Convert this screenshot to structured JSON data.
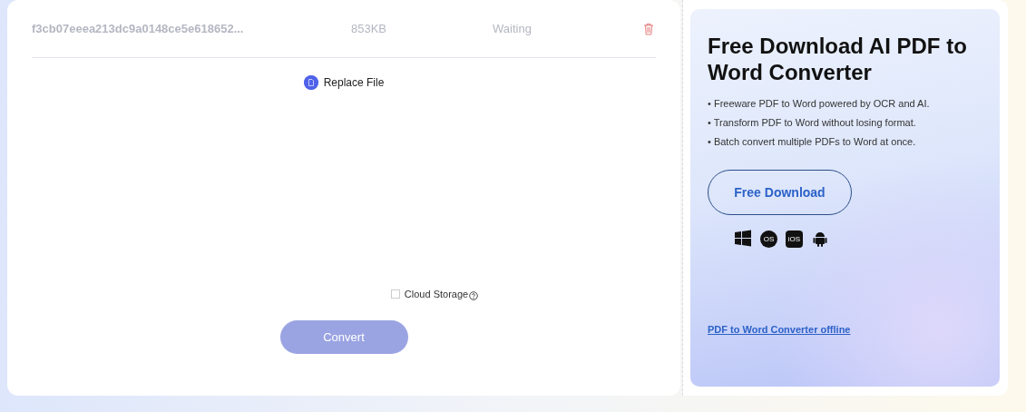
{
  "file_row": {
    "name": "f3cb07eeea213dc9a0148ce5e618652...",
    "size": "853KB",
    "status": "Waiting"
  },
  "replace_button": {
    "label": "Replace File"
  },
  "cloud_storage": {
    "label": "Cloud Storage",
    "checked": false
  },
  "convert_button": {
    "label": "Convert",
    "disabled": true
  },
  "promo": {
    "title": "Free Download AI PDF to Word Converter",
    "bullets": [
      "• Freeware PDF to Word powered by OCR and AI.",
      "• Transform PDF to Word without losing format.",
      "• Batch convert multiple PDFs to Word at once."
    ],
    "download_button": "Free Download",
    "platforms": [
      {
        "kind": "windows"
      },
      {
        "kind": "macos",
        "text": "OS"
      },
      {
        "kind": "ios",
        "text": "iOS"
      },
      {
        "kind": "android"
      }
    ],
    "link": "PDF to Word Converter offline"
  }
}
